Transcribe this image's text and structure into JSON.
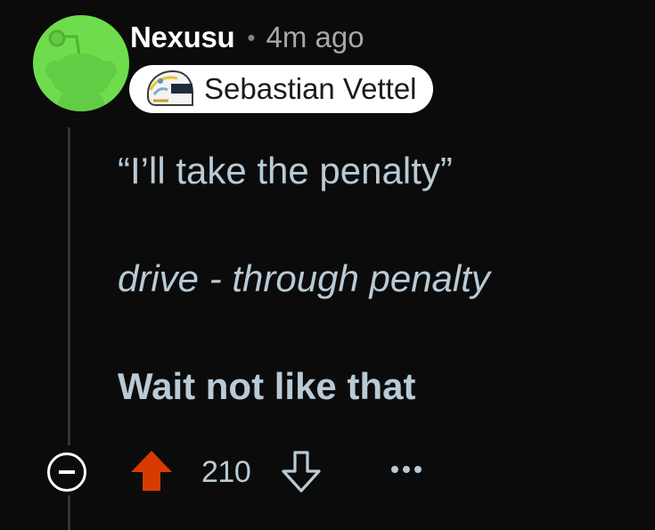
{
  "comment": {
    "author": "Nexusu",
    "separator": "•",
    "timestamp": "4m ago",
    "flair": {
      "icon": "racing-helmet-icon",
      "text": "Sebastian Vettel"
    },
    "body": {
      "line1": "“I’ll take the penalty”",
      "line2": "drive - through penalty",
      "line3": "Wait not like that"
    },
    "actions": {
      "collapse_icon": "minus-circle-icon",
      "upvote_icon": "arrow-up-icon",
      "upvoted": true,
      "score": "210",
      "downvote_icon": "arrow-down-icon",
      "more_icon": "ellipsis-icon"
    }
  },
  "colors": {
    "background": "#0b0b0b",
    "username": "#ffffff",
    "timestamp": "#a4a7a9",
    "body_text": "#b8cad6",
    "upvote_active": "#d93a00",
    "avatar_bg": "#6fdc4e",
    "flair_bg": "#ffffff",
    "thread_line": "#343536"
  }
}
